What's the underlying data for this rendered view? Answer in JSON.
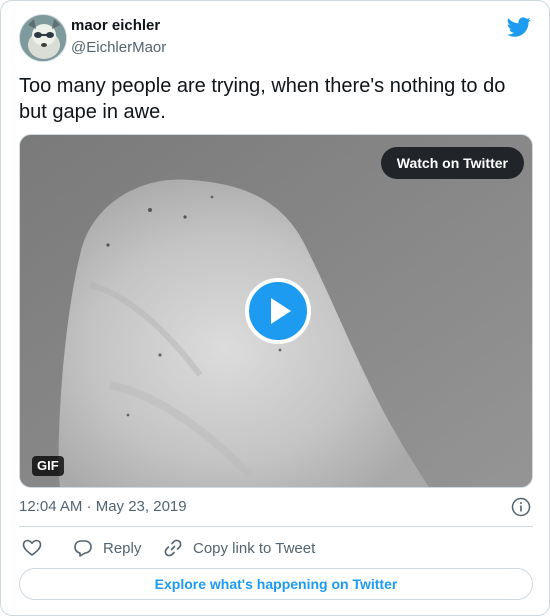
{
  "author": {
    "name": "maor eichler",
    "handle": "@EichlerMaor",
    "avatar_icon": "avatar-image"
  },
  "tweet": {
    "text": "Too many people are trying, when there's nothing to do but gape in awe."
  },
  "media": {
    "watch_label": "Watch on Twitter",
    "badge": "GIF",
    "play_icon": "play-icon"
  },
  "meta": {
    "time": "12:04 AM · May 23, 2019"
  },
  "actions": {
    "like_icon": "heart-icon",
    "reply_label": "Reply",
    "copy_label": "Copy link to Tweet"
  },
  "footer": {
    "explore_label": "Explore what's happening on Twitter"
  },
  "colors": {
    "accent": "#1d9bf0",
    "text": "#0f1419",
    "muted": "#536471",
    "border": "#cfd9de"
  }
}
